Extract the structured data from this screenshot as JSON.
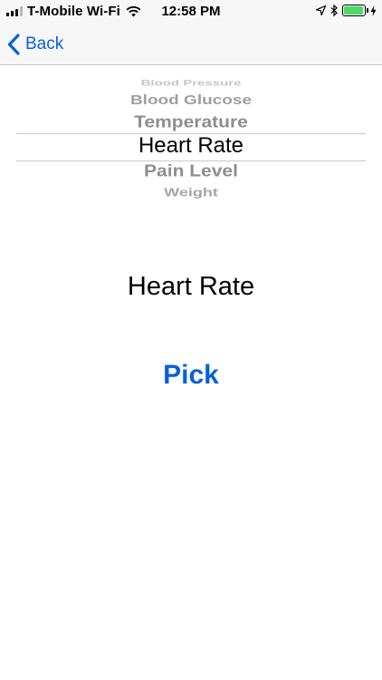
{
  "status_bar": {
    "carrier": "T-Mobile Wi-Fi",
    "time": "12:58 PM",
    "battery_level_percent": 95,
    "battery_color": "#4cd964"
  },
  "nav": {
    "back_label": "Back",
    "accent_color": "#0a60d8"
  },
  "picker": {
    "items": [
      "Blood Pressure",
      "Blood Glucose",
      "Temperature",
      "Heart Rate",
      "Pain Level",
      "Weight"
    ],
    "selected_index": 3
  },
  "main": {
    "selected_label": "Heart Rate",
    "pick_label": "Pick"
  }
}
